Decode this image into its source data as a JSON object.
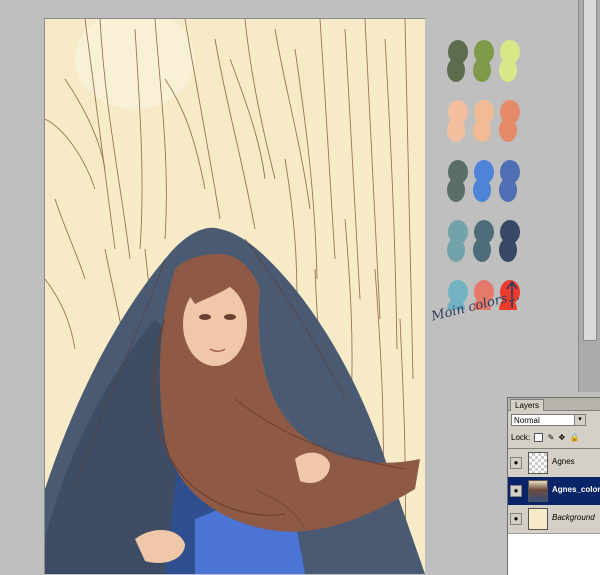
{
  "swatch_colors": [
    [
      "#5d6b4f",
      "#7e9a4a",
      "#d8e887"
    ],
    [
      "#f4bf9e",
      "#f2bb95",
      "#e58b69"
    ],
    [
      "#5a6e6a",
      "#4d84d8",
      "#4e6fb4"
    ],
    [
      "#71a3a9",
      "#4d6c78",
      "#384766"
    ],
    [
      "#73b2c3",
      "#e57a6a",
      "#ef3b2d"
    ]
  ],
  "note": {
    "text": "Moin colors..."
  },
  "layers_panel": {
    "tab_label": "Layers",
    "blend_mode": "Normal",
    "lock_label": "Lock:",
    "layers": [
      {
        "name": "Agnes",
        "thumbnail": "transparent",
        "selected": false,
        "visible": true
      },
      {
        "name": "Agnes_color",
        "thumbnail": "color",
        "selected": true,
        "visible": true
      },
      {
        "name": "Background",
        "thumbnail": "bg",
        "selected": false,
        "visible": true
      }
    ]
  },
  "icons": {
    "visibility": "eye-icon",
    "dropdown": "chevron-down-icon",
    "lock_transparent": "checker-lock-icon",
    "lock_paint": "brush-lock-icon",
    "lock_move": "move-lock-icon",
    "lock_all": "padlock-icon"
  }
}
